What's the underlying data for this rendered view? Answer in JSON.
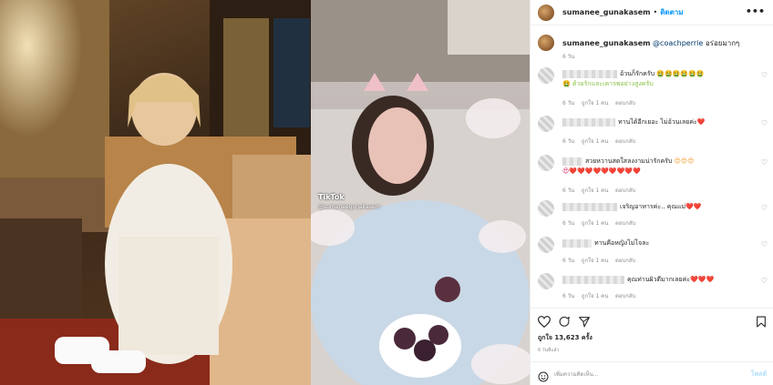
{
  "post": {
    "username": "sumanee_gunakasem",
    "follow_label": "ติดตาม",
    "more_label": "•••",
    "caption_mention": "@coachperrie",
    "caption_text": "อร่อยมากๆ",
    "caption_time": "6 วัน",
    "likes_label": "ถูกใจ 13,623 ครั้ง",
    "date_label": "6 วันที่แล้ว",
    "add_comment_placeholder": "เพิ่มความคิดเห็น...",
    "post_button": "โพสต์"
  },
  "overlay": {
    "tiktok_label": "TikTok",
    "tiktok_user": "@sumaneegunakasem"
  },
  "comments": [
    {
      "text": "อ้วนก็รักครับ",
      "emoji": "🤮🤮🤮🤮🤮🤮",
      "line2": "🤮 ด้วยรักและเคารพอย่างสูงครับ",
      "time": "6 วัน",
      "likes": "ถูกใจ 1 คน",
      "reply": "ตอบกลับ"
    },
    {
      "text": "ทานได้อีกเยอะ ไม่อ้วนเลยค่ะ",
      "emoji": "❤️",
      "line2": "",
      "time": "6 วัน",
      "likes": "ถูกใจ 1 คน",
      "reply": "ตอบกลับ"
    },
    {
      "text": "สวยหวานสดใสลงงามน่ารักครับ",
      "emoji": "😍😍😍",
      "line2": "😍❤️❤️❤️❤️❤️❤️❤️❤️❤️",
      "time": "6 วัน",
      "likes": "ถูกใจ 1 คน",
      "reply": "ตอบกลับ"
    },
    {
      "text": "เจริญอาหารค่ะ.. คุณแม่",
      "emoji": "❤️❤️",
      "line2": "",
      "time": "6 วัน",
      "likes": "ถูกใจ 1 คน",
      "reply": "ตอบกลับ"
    },
    {
      "text": "ทานคือหญิงไม่โจละ",
      "emoji": "",
      "line2": "",
      "time": "6 วัน",
      "likes": "ถูกใจ 1 คน",
      "reply": "ตอบกลับ"
    },
    {
      "text": "คุณท่านผิวดีมากเลยค่ะ",
      "emoji": "❤️❤️❤️",
      "line2": "",
      "time": "6 วัน",
      "likes": "ถูกใจ 1 คน",
      "reply": "ตอบกลับ"
    }
  ],
  "icons": [
    "heart-icon",
    "comment-icon",
    "share-icon",
    "bookmark-icon",
    "emoji-icon",
    "more-icon"
  ]
}
